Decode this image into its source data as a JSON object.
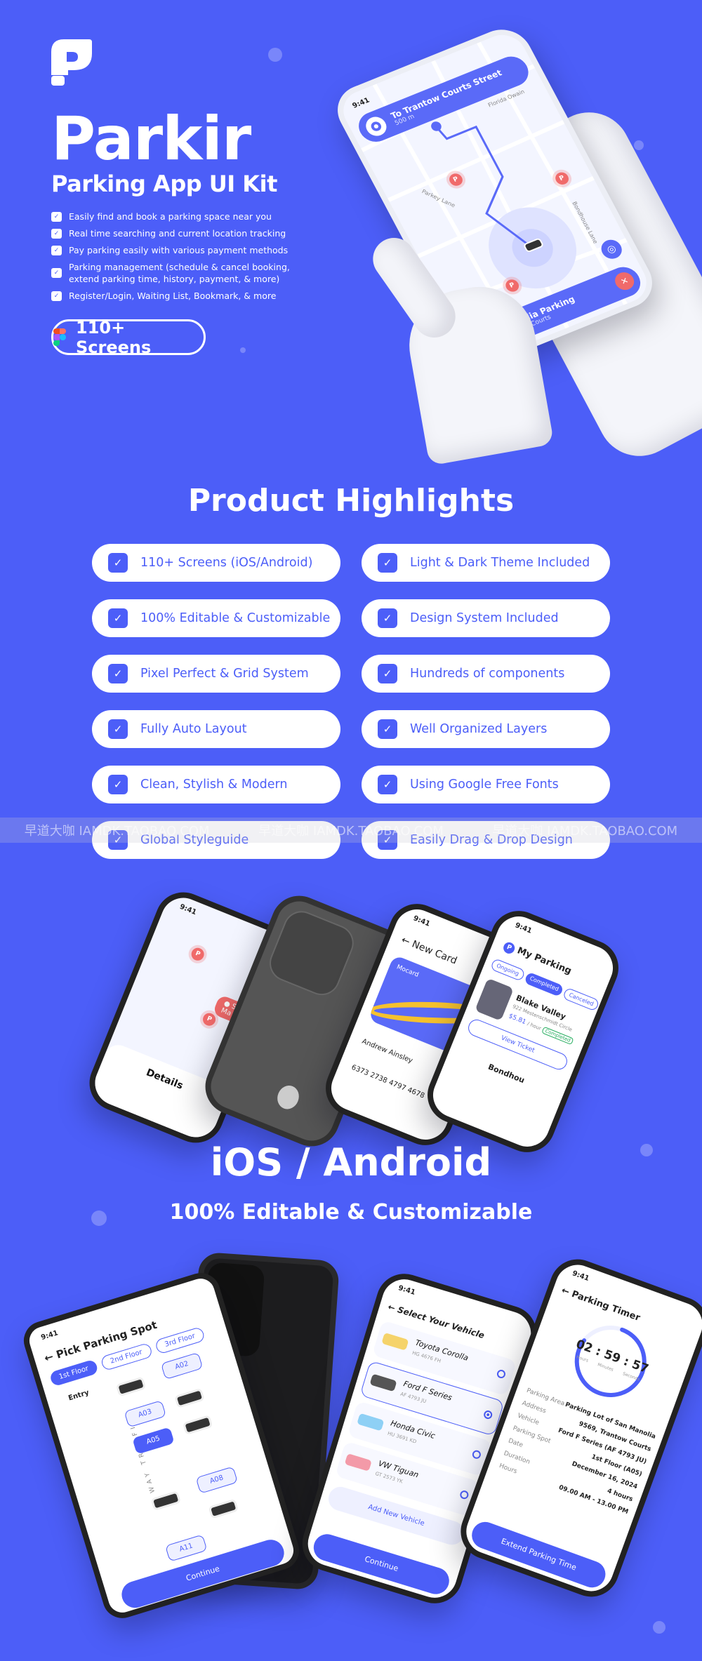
{
  "brand": {
    "name": "Parkir",
    "tagline": "Parking App UI Kit",
    "accent": "#4c5ef8",
    "logo": "parkir-p-logo"
  },
  "features": [
    "Easily find and book a parking space near you",
    "Real time searching and current location tracking",
    "Pay parking easily with various payment methods",
    "Parking management (schedule & cancel booking, extend parking time, history, payment, & more)",
    "Register/Login, Waiting List, Bookmark, & more"
  ],
  "screens_button": {
    "label": "110+ Screens",
    "icon": "figma-icon"
  },
  "hero_phone": {
    "time": "9:41",
    "route_title": "To Trantow Courts Street",
    "route_distance": "500 m",
    "street_1": "Florida Owain",
    "street_2": "Parkey Lane",
    "street_3": "Bondhouse Lane",
    "destination": "San Manolia Parking",
    "destination_address": "9569, Trantow Courts",
    "pin_label": "P"
  },
  "highlights": {
    "title": "Product Highlights",
    "items": [
      "110+ Screens (iOS/Android)",
      "Light & Dark Theme Included",
      "100% Editable & Customizable",
      "Design System Included",
      "Pixel Perfect & Grid System",
      "Hundreds of components",
      "Fully Auto Layout",
      "Well Organized Layers",
      "Clean, Stylish & Modern",
      "Using Google Free Fonts",
      "Global Styleguide",
      "Easily Drag & Drop Design"
    ]
  },
  "watermark": [
    "早道大咖 IAMDK.TAOBAO.COM",
    "早道大咖 IAMDK.TAOBAO.COM",
    "早道大咖 IAMDK.TAOBAO.COM"
  ],
  "showcase": {
    "map_phone": {
      "time": "9:41",
      "chip": "San Ma",
      "section": "Details"
    },
    "card_phone": {
      "time": "9:41",
      "title": "New Card",
      "card_brand": "Mocard",
      "holder": "Andrew Ainsley",
      "number": "6373 2738 4797 4678"
    },
    "my_parking_phone": {
      "time": "9:41",
      "title": "My Parking",
      "tabs": [
        "Ongoing",
        "Completed",
        "Canceled"
      ],
      "item_name": "Blake Valley",
      "item_address": "922 Mestenschmidt Circle",
      "item_price": "$5.81",
      "item_unit": "/ hour",
      "item_status": "Completed",
      "view_ticket": "View Ticket",
      "next_item": "Bondhou"
    }
  },
  "platforms": {
    "title": "iOS / Android",
    "subtitle": "100% Editable & Customizable"
  },
  "pick_spot": {
    "time": "9:41",
    "title": "Pick Parking Spot",
    "floors": [
      "1st Floor",
      "2nd Floor",
      "3rd Floor"
    ],
    "entry": "Entry",
    "traffic": "2 WAY TRAFFIC",
    "spots": [
      "A02",
      "A03",
      "A05",
      "A08",
      "A11"
    ],
    "selected": "A05",
    "continue": "Continue"
  },
  "select_vehicle": {
    "time": "9:41",
    "title": "Select Your Vehicle",
    "vehicles": [
      {
        "name": "Toyota Corolla",
        "plate": "HG 4676 FH"
      },
      {
        "name": "Ford F Series",
        "plate": "AF 4793 JU"
      },
      {
        "name": "Honda Civic",
        "plate": "HU 3691 KD"
      },
      {
        "name": "VW Tiguan",
        "plate": "GT 2573 YK"
      }
    ],
    "selected": "Ford F Series",
    "add": "Add New Vehicle",
    "continue": "Continue"
  },
  "timer": {
    "time": "9:41",
    "title": "Parking Timer",
    "hours": "02",
    "minutes": "59",
    "seconds": "57",
    "hours_label": "Hours",
    "minutes_label": "Minutes",
    "seconds_label": "Seconds",
    "progress": 0.8,
    "details": [
      {
        "k": "Parking Area",
        "v": "Parking Lot of San Manolia"
      },
      {
        "k": "Address",
        "v": "9569, Trantow Courts"
      },
      {
        "k": "Vehicle",
        "v": "Ford F Series (AF 4793 JU)"
      },
      {
        "k": "Parking Spot",
        "v": "1st Floor (A05)"
      },
      {
        "k": "Date",
        "v": "December 16, 2024"
      },
      {
        "k": "Duration",
        "v": "4 hours"
      },
      {
        "k": "Hours",
        "v": "09.00 AM - 13.00 PM"
      }
    ],
    "button": "Extend Parking Time"
  }
}
